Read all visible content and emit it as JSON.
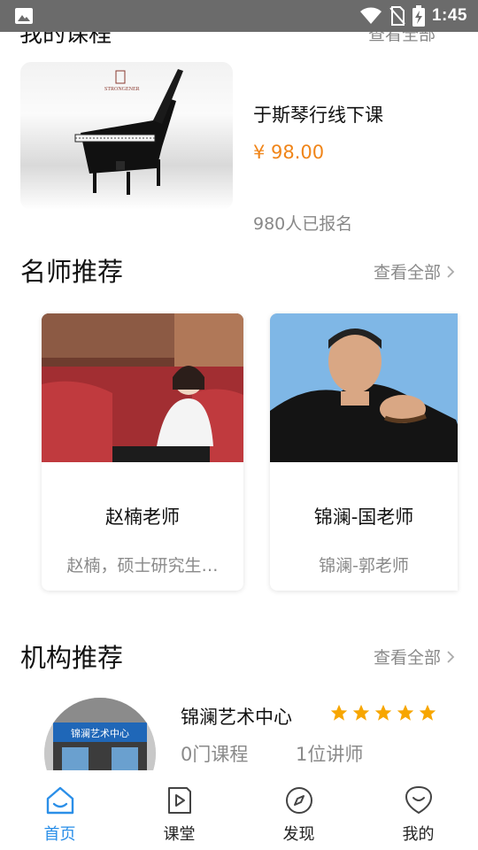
{
  "status_bar": {
    "time": "1:45",
    "icons": [
      "gallery-icon",
      "wifi-icon",
      "no-sim-icon",
      "battery-charging-icon"
    ]
  },
  "peek_section": {
    "title": "我的课程",
    "more": "查看全部"
  },
  "course": {
    "title": "于斯琴行线下课",
    "price": "¥ 98.00",
    "enrolled": "980人已报名",
    "thumb_brand": "STRONGENER"
  },
  "teachers_section": {
    "title": "名师推荐",
    "see_all": "查看全部",
    "teachers": [
      {
        "name": "赵楠老师",
        "desc": "赵楠，硕士研究生…"
      },
      {
        "name": "锦澜-国老师",
        "desc": "锦澜-郭老师"
      }
    ]
  },
  "orgs_section": {
    "title": "机构推荐",
    "see_all": "查看全部",
    "org": {
      "name": "锦澜艺术中心",
      "rating": 5,
      "courses": "0门课程",
      "teachers": "1位讲师",
      "logo_text": "锦澜艺术中心"
    }
  },
  "bottom_nav": {
    "items": [
      {
        "label": "首页",
        "icon": "home-icon",
        "active": true
      },
      {
        "label": "课堂",
        "icon": "classroom-play-icon",
        "active": false
      },
      {
        "label": "发现",
        "icon": "compass-icon",
        "active": false
      },
      {
        "label": "我的",
        "icon": "profile-smile-icon",
        "active": false
      }
    ]
  },
  "colors": {
    "accent": "#2b8fe8",
    "price": "#f08519",
    "star": "#f7a600",
    "status_bar": "#6b6b6b"
  }
}
